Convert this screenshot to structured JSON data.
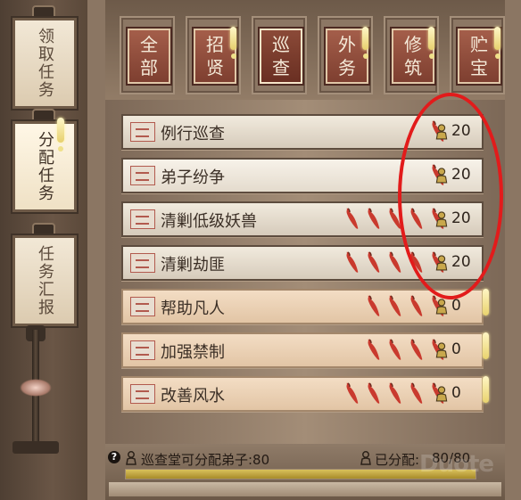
{
  "sidebar": {
    "tabs": [
      {
        "label": "领取任务",
        "active": false,
        "alert": false
      },
      {
        "label": "分配任务",
        "active": true,
        "alert": true
      },
      {
        "label": "任务汇报",
        "active": false,
        "alert": false
      }
    ]
  },
  "categories": [
    {
      "label": "全部",
      "active": false,
      "alert": false
    },
    {
      "label": "招贤",
      "active": false,
      "alert": true
    },
    {
      "label": "巡查",
      "active": true,
      "alert": false
    },
    {
      "label": "外务",
      "active": false,
      "alert": true
    },
    {
      "label": "修筑",
      "active": false,
      "alert": true
    },
    {
      "label": "贮宝",
      "active": false,
      "alert": true
    }
  ],
  "tasks": [
    {
      "name": "例行巡查",
      "difficulty": 1,
      "count": "20",
      "assigned": true,
      "alert": false
    },
    {
      "name": "弟子纷争",
      "difficulty": 1,
      "count": "20",
      "assigned": true,
      "alert": false
    },
    {
      "name": "清剿低级妖兽",
      "difficulty": 5,
      "count": "20",
      "assigned": true,
      "alert": false
    },
    {
      "name": "清剿劫匪",
      "difficulty": 5,
      "count": "20",
      "assigned": true,
      "alert": false
    },
    {
      "name": "帮助凡人",
      "difficulty": 4,
      "count": "0",
      "assigned": false,
      "alert": true
    },
    {
      "name": "加强禁制",
      "difficulty": 4,
      "count": "0",
      "assigned": false,
      "alert": true
    },
    {
      "name": "改善风水",
      "difficulty": 5,
      "count": "0",
      "assigned": false,
      "alert": true
    }
  ],
  "footer": {
    "help": "?",
    "available_label": "巡查堂可分配弟子:80",
    "assigned_label": "已分配:",
    "assigned_value": "80/80",
    "progress": 1.0
  },
  "watermark": "Duote",
  "colors": {
    "accent_red": "#e21b1b",
    "button_red": "#a45e4a",
    "pepper": "#c93a2e",
    "progress": "#d9c15b"
  }
}
